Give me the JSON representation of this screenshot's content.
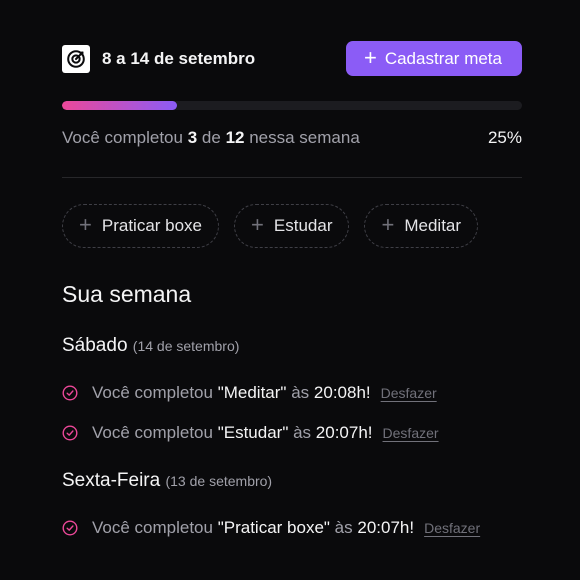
{
  "header": {
    "date_range": "8 a 14 de setembro",
    "create_button_label": "Cadastrar meta",
    "plus_symbol": "+",
    "logo_icon": "target-arrow-icon"
  },
  "progress": {
    "fraction": 0.25,
    "prefix": "Você completou",
    "completed": "3",
    "of": "de",
    "total": "12",
    "suffix": "nessa semana",
    "percent_label": "25%"
  },
  "pending_goals": [
    {
      "label": "Praticar boxe"
    },
    {
      "label": "Estudar"
    },
    {
      "label": "Meditar"
    }
  ],
  "week": {
    "title": "Sua semana",
    "days": [
      {
        "name": "Sábado",
        "date": "(14 de setembro)",
        "entries": [
          {
            "prefix": "Você completou",
            "goal": "\"Meditar\"",
            "at": "às",
            "time": "20:08h!",
            "undo": "Desfazer"
          },
          {
            "prefix": "Você completou",
            "goal": "\"Estudar\"",
            "at": "às",
            "time": "20:07h!",
            "undo": "Desfazer"
          }
        ]
      },
      {
        "name": "Sexta-Feira",
        "date": "(13 de setembro)",
        "entries": [
          {
            "prefix": "Você completou",
            "goal": "\"Praticar boxe\"",
            "at": "às",
            "time": "20:07h!",
            "undo": "Desfazer"
          }
        ]
      }
    ]
  },
  "colors": {
    "background": "#0a0a0c",
    "accent": "#8b5cf6",
    "gradient_start": "#ec4899",
    "check": "#ec4899"
  }
}
